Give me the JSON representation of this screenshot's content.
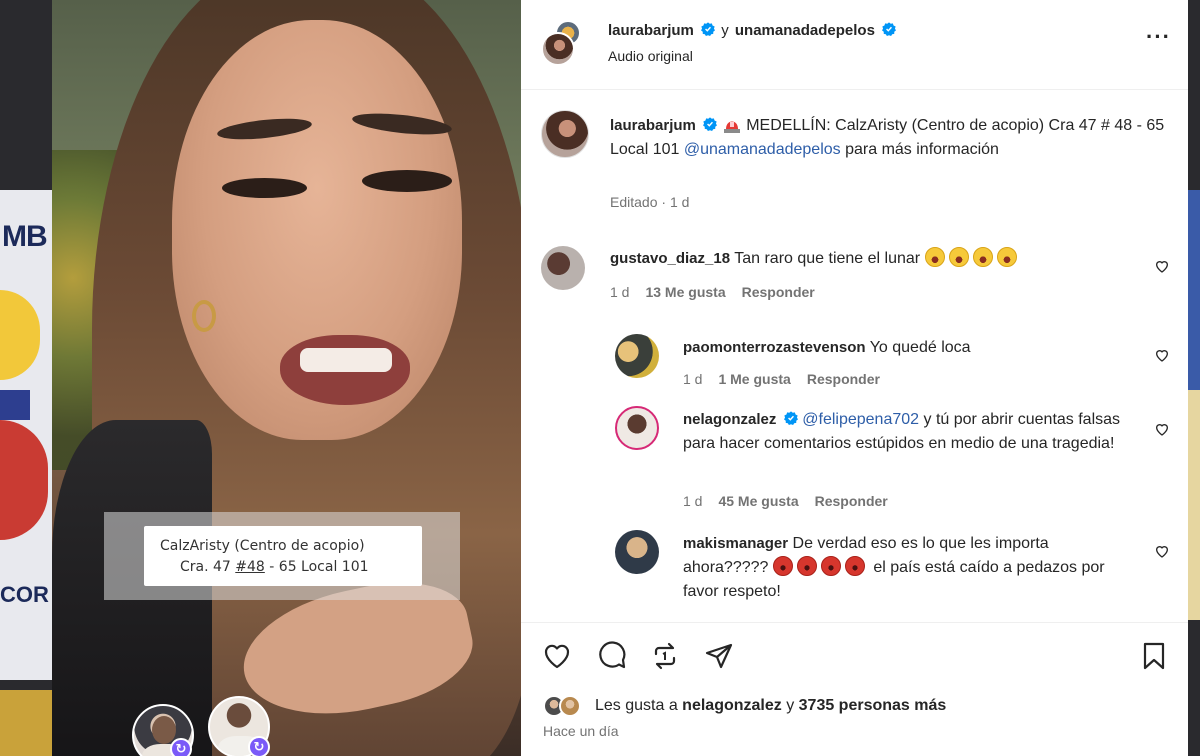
{
  "background": {
    "left_poster_text_top": "MB",
    "left_poster_text_bottom": "COR"
  },
  "video": {
    "sticker_line1": "CalzAristy (Centro de acopio)",
    "sticker_line2_prefix": "Cra. 47 ",
    "sticker_line2_hashtag": "#48",
    "sticker_line2_suffix": " - 65 Local 101"
  },
  "header": {
    "user1": "laurabarjum",
    "joiner": "y",
    "user2": "unamanadadepelos",
    "audio": "Audio original",
    "more_icon": "more-horizontal-icon"
  },
  "caption": {
    "username": "laurabarjum",
    "text_before": " MEDELLÍN: CalzAristy (Centro de acopio) Cra 47 # 48 - 65 Local 101 ",
    "mention": "@unamanadadepelos",
    "text_after": " para más información",
    "edited": "Editado",
    "time": "1 d"
  },
  "comments": [
    {
      "username": "gustavo_diaz_18",
      "text": "Tan raro que tiene el lunar",
      "time": "1 d",
      "likes": "13 Me gusta",
      "reply": "Responder"
    },
    {
      "username": "paomonterrozastevenson",
      "text": "Yo quedé loca",
      "time": "1 d",
      "likes": "1 Me gusta",
      "reply": "Responder"
    },
    {
      "username": "nelagonzalez",
      "mention": "@felipepena702",
      "text": " y tú por abrir cuentas falsas para hacer comentarios estúpidos en medio de una tragedia!",
      "time": "1 d",
      "likes": "45 Me gusta",
      "reply": "Responder"
    },
    {
      "username": "makismanager",
      "text_before": "De verdad eso es lo que les importa ahora?????",
      "text_after": " el país está caído a pedazos por favor respeto!"
    }
  ],
  "footer": {
    "likes_prefix": "Les gusta a ",
    "likes_user": "nelagonzalez",
    "likes_middle": " y ",
    "likes_count": "3735 personas más",
    "time_ago": "Hace un día"
  },
  "colors": {
    "verified": "#0095f6",
    "mention": "#2e5ea8",
    "muted": "#737373",
    "text": "#262626",
    "story_ring": "#d62976"
  }
}
